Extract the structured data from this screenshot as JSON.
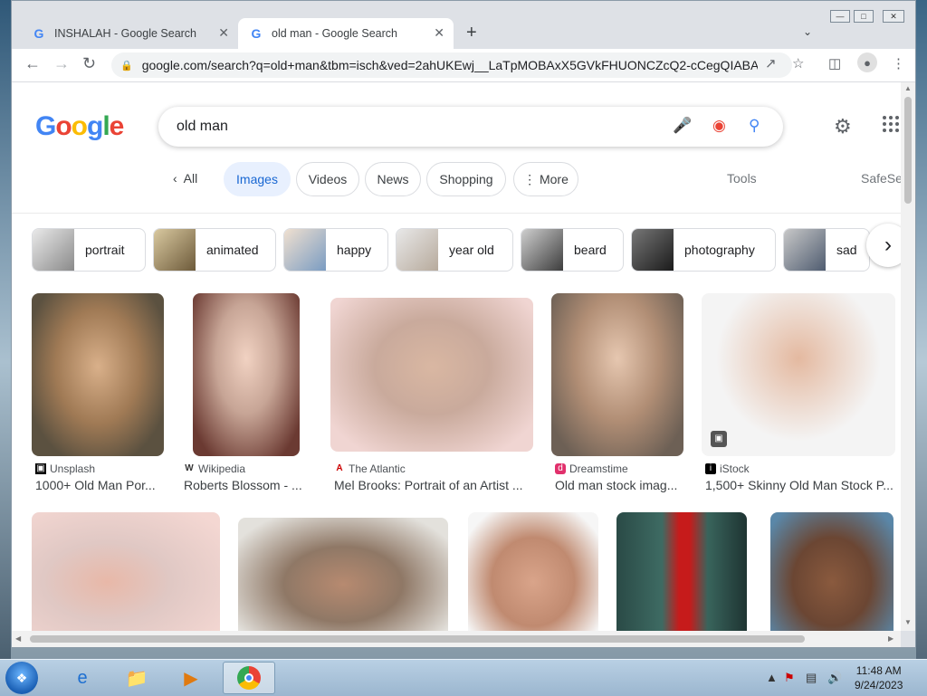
{
  "browser": {
    "tabs": [
      {
        "title": "INSHALAH - Google Search",
        "active": false
      },
      {
        "title": "old man - Google Search",
        "active": true
      }
    ],
    "url": "google.com/search?q=old+man&tbm=isch&ved=2ahUKEwj__LaTpMOBAxX5GVkFHUONCZcQ2-cCegQIABA..."
  },
  "search": {
    "logo": "Google",
    "query": "old man"
  },
  "filters": {
    "back_label": "All",
    "chips": [
      "Images",
      "Videos",
      "News",
      "Shopping",
      "More"
    ],
    "tools": "Tools",
    "safesearch": "SafeSe"
  },
  "related": [
    "portrait",
    "animated",
    "happy",
    "year old",
    "beard",
    "photography",
    "sad"
  ],
  "results_row1": [
    {
      "source": "Unsplash",
      "caption": "1000+ Old Man Por..."
    },
    {
      "source": "Wikipedia",
      "caption": "Roberts Blossom - ..."
    },
    {
      "source": "The Atlantic",
      "caption": "Mel Brooks: Portrait of an Artist ..."
    },
    {
      "source": "Dreamstime",
      "caption": "Old man stock imag..."
    },
    {
      "source": "iStock",
      "caption": "1,500+ Skinny Old Man Stock P..."
    }
  ],
  "taskbar": {
    "time": "11:48 AM",
    "date": "9/24/2023"
  }
}
